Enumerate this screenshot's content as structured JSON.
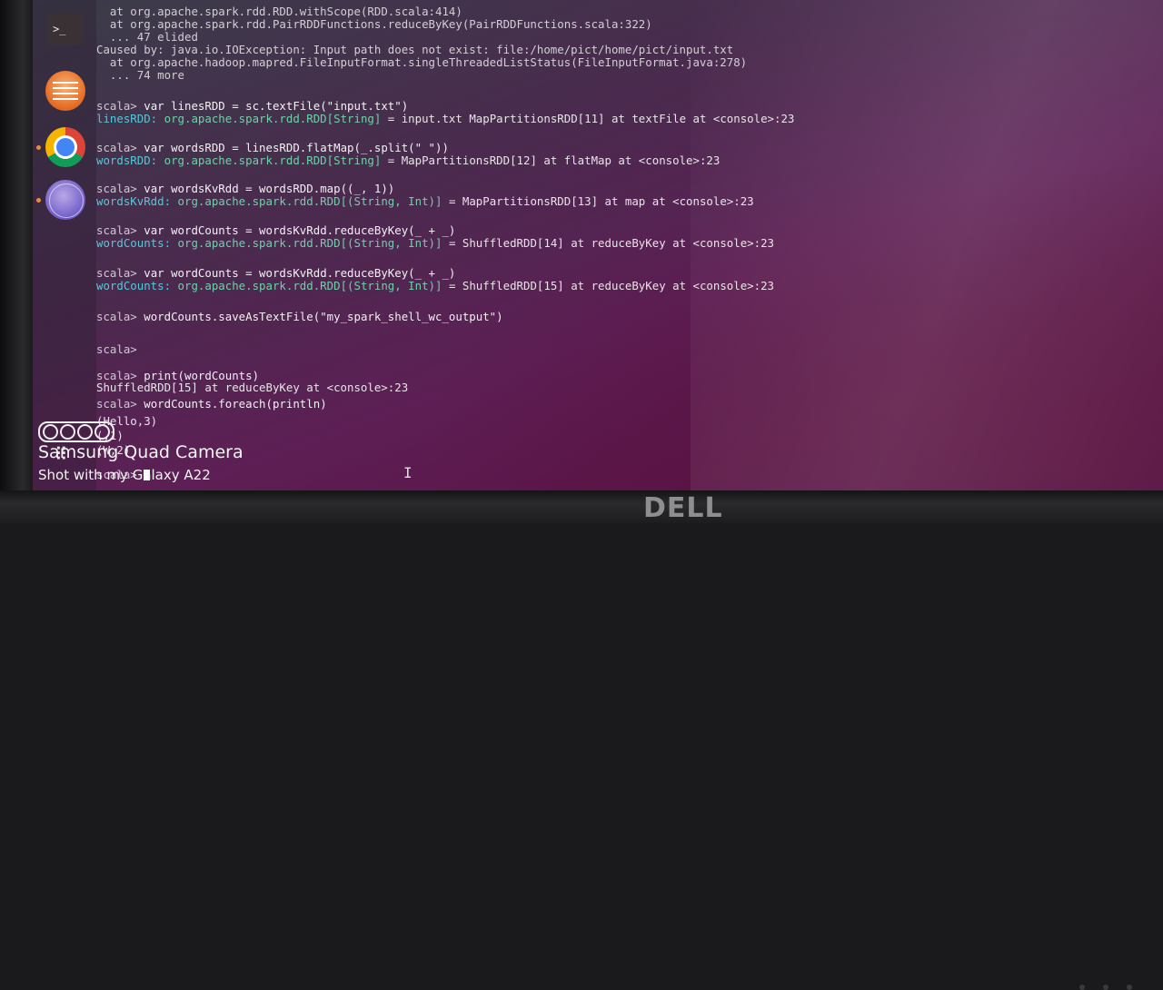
{
  "launcher": {
    "items": [
      {
        "name": "Terminal",
        "glyph": ">_"
      },
      {
        "name": "Files"
      },
      {
        "name": "Google Chrome"
      },
      {
        "name": "Web Browser"
      }
    ],
    "apps_glyph": "⠿"
  },
  "terminal": {
    "lines": [
      {
        "indent": "  ",
        "text": "at org.apache.spark.rdd.RDD.withScope(RDD.scala:414)"
      },
      {
        "indent": "  ",
        "text": "at org.apache.spark.rdd.PairRDDFunctions.reduceByKey(PairRDDFunctions.scala:322)"
      },
      {
        "indent": "  ",
        "text": "... 47 elided"
      },
      {
        "indent": "",
        "text": "Caused by: java.io.IOException: Input path does not exist: file:/home/pict/home/pict/input.txt"
      },
      {
        "indent": "  ",
        "text": "at org.apache.hadoop.mapred.FileInputFormat.singleThreadedListStatus(FileInputFormat.java:278)"
      },
      {
        "indent": "  ",
        "text": "... 74 more"
      }
    ],
    "prompt": "scala>",
    "commands": [
      {
        "cmd": "var linesRDD = sc.textFile(\"input.txt\")",
        "result_name": "linesRDD:",
        "result_type": "org.apache.spark.rdd.RDD[String]",
        "result_rest": "= input.txt MapPartitionsRDD[11] at textFile at <console>:23"
      },
      {
        "cmd": "var wordsRDD = linesRDD.flatMap(_.split(\" \"))",
        "result_name": "wordsRDD:",
        "result_type": "org.apache.spark.rdd.RDD[String]",
        "result_rest": "= MapPartitionsRDD[12] at flatMap at <console>:23"
      },
      {
        "cmd": "var wordsKvRdd = wordsRDD.map((_, 1))",
        "result_name": "wordsKvRdd:",
        "result_type": "org.apache.spark.rdd.RDD[(String, Int)]",
        "result_rest": "= MapPartitionsRDD[13] at map at <console>:23"
      },
      {
        "cmd": "var wordCounts = wordsKvRdd.reduceByKey(_ + _)",
        "result_name": "wordCounts:",
        "result_type": "org.apache.spark.rdd.RDD[(String, Int)]",
        "result_rest": "= ShuffledRDD[14] at reduceByKey at <console>:23"
      },
      {
        "cmd": "var wordCounts = wordsKvRdd.reduceByKey(_ + _)",
        "result_name": "wordCounts:",
        "result_type": "org.apache.spark.rdd.RDD[(String, Int)]",
        "result_rest": "= ShuffledRDD[15] at reduceByKey at <console>:23"
      },
      {
        "cmd": "wordCounts.saveAsTextFile(\"my_spark_shell_wc_output\")"
      },
      {
        "cmd": ""
      },
      {
        "cmd": "print(wordCounts)"
      },
      {
        "output": "ShuffledRDD[15] at reduceByKey at <console>:23"
      },
      {
        "cmd": "wordCounts.foreach(println)"
      },
      {
        "output": "(Hello,3)"
      },
      {
        "output": "(,1)"
      },
      {
        "output": "(W,2)"
      }
    ]
  },
  "watermark": {
    "line1": "Samsung Quad Camera",
    "line2": "Shot with my Galaxy A22"
  },
  "monitor": {
    "brand": "DELL"
  }
}
